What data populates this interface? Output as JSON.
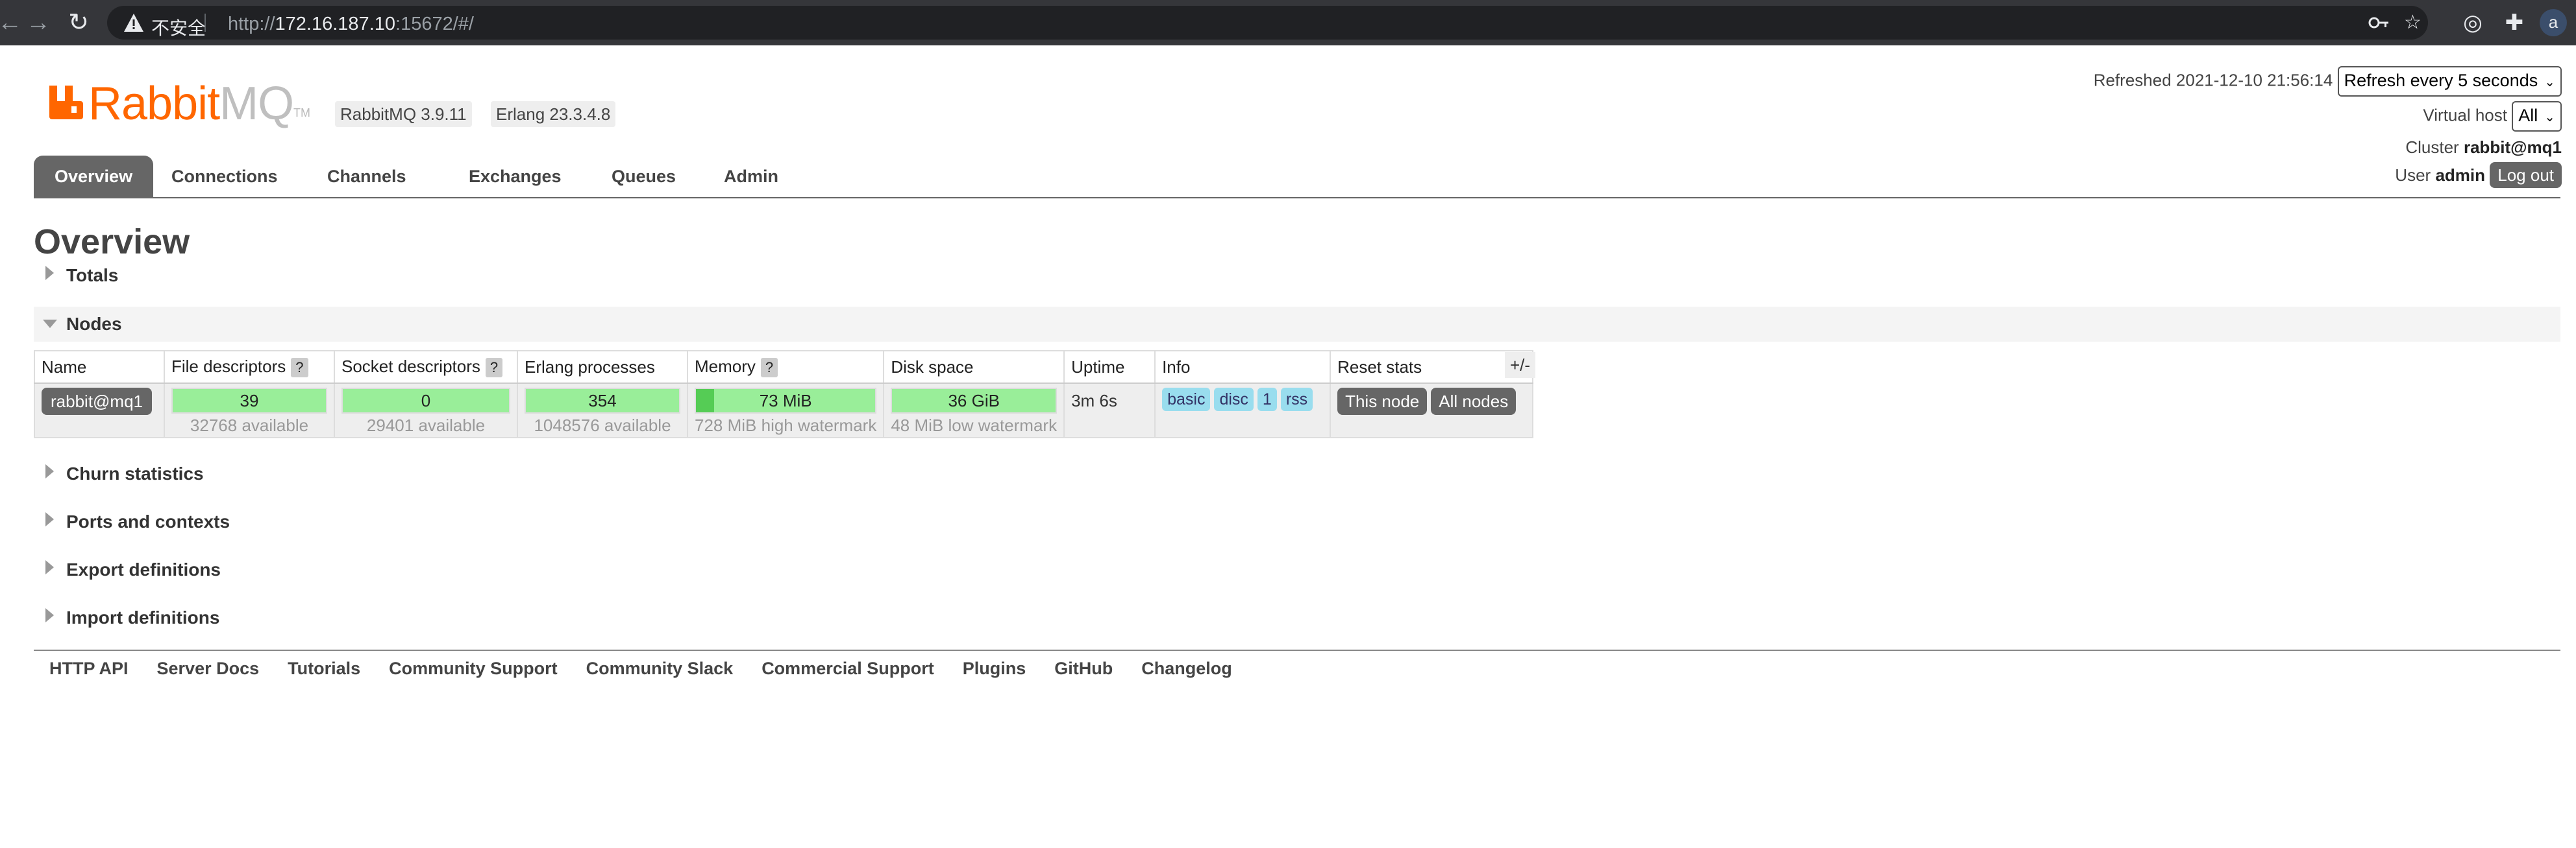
{
  "browser": {
    "insecure_label": "不安全",
    "url_scheme": "http://",
    "url_host": "172.16.187.10",
    "url_rest": ":15672/#/",
    "profile_initial": "a"
  },
  "header": {
    "logo_rabbit": "Rabbit",
    "logo_mq": "MQ",
    "logo_tm": "TM",
    "rabbitmq_version": "RabbitMQ 3.9.11",
    "erlang_version": "Erlang 23.3.4.8",
    "refreshed_label": "Refreshed",
    "refreshed_time": "2021-12-10 21:56:14",
    "refresh_select": "Refresh every 5 seconds",
    "vhost_label": "Virtual host",
    "vhost_select": "All",
    "cluster_label": "Cluster",
    "cluster_name": "rabbit@mq1",
    "user_label": "User",
    "user_name": "admin",
    "logout_label": "Log out"
  },
  "tabs": [
    "Overview",
    "Connections",
    "Channels",
    "Exchanges",
    "Queues",
    "Admin"
  ],
  "page_title": "Overview",
  "sections": {
    "totals": "Totals",
    "nodes": "Nodes",
    "churn": "Churn statistics",
    "ports": "Ports and contexts",
    "export": "Export definitions",
    "import": "Import definitions"
  },
  "nodes_table": {
    "headers": {
      "name": "Name",
      "file_descriptors": "File descriptors",
      "socket_descriptors": "Socket descriptors",
      "erlang_processes": "Erlang processes",
      "memory": "Memory",
      "disk_space": "Disk space",
      "uptime": "Uptime",
      "info": "Info",
      "reset_stats": "Reset stats"
    },
    "help_mark": "?",
    "columns_toggle": "+/-",
    "row": {
      "name": "rabbit@mq1",
      "file_descriptors": "39",
      "file_descriptors_available": "32768 available",
      "socket_descriptors": "0",
      "socket_descriptors_available": "29401 available",
      "erlang_processes": "354",
      "erlang_processes_available": "1048576 available",
      "memory": "73 MiB",
      "memory_watermark": "728 MiB high watermark",
      "disk_space": "36 GiB",
      "disk_watermark": "48 MiB low watermark",
      "uptime": "3m 6s",
      "info_badges": [
        "basic",
        "disc",
        "1",
        "rss"
      ],
      "reset_this_node": "This node",
      "reset_all_nodes": "All nodes"
    }
  },
  "gauge_levels": {
    "memory_fraction": 0.1
  },
  "footer_links": [
    "HTTP API",
    "Server Docs",
    "Tutorials",
    "Community Support",
    "Community Slack",
    "Commercial Support",
    "Plugins",
    "GitHub",
    "Changelog"
  ],
  "colors": {
    "brand_orange": "#ff6600",
    "gauge_green": "#99ee99",
    "tab_active": "#666666",
    "info_badge": "#99ddee"
  },
  "icons": [
    "back-arrow-icon",
    "forward-arrow-icon",
    "reload-icon",
    "warning-icon",
    "key-icon",
    "star-icon",
    "reader-mode-icon",
    "puzzle-extension-icon"
  ]
}
